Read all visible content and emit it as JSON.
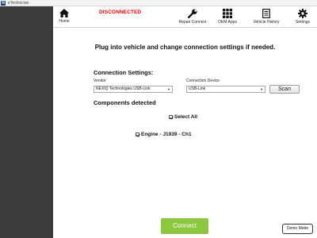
{
  "window": {
    "logo": "N",
    "title": "eTechnician"
  },
  "header": {
    "connection_status": "DISCONNECTED",
    "nav": [
      {
        "label": "Home",
        "icon": "home-icon"
      },
      {
        "label": "Repair Connect",
        "icon": "wrench-icon"
      },
      {
        "label": "OEM Apps",
        "icon": "grid-icon"
      },
      {
        "label": "Vehicle History",
        "icon": "document-icon"
      },
      {
        "label": "Settings",
        "icon": "gear-icon"
      }
    ]
  },
  "main": {
    "instruction": "Plug into vehicle and change connection settings if needed.",
    "connection_settings": {
      "title": "Connection Settings:",
      "vendor_label": "Vendor",
      "vendor_value": "NEXIQ Technologies USB-Link",
      "device_label": "Connection Device",
      "device_value": "USB-Link",
      "scan_label": "Scan"
    },
    "components": {
      "title": "Components detected",
      "select_all_label": "Select All",
      "select_all_checked": true,
      "items": [
        {
          "label": "Engine - J1939 - Ch1",
          "checked": true
        }
      ]
    },
    "connect_label": "Connect",
    "demo_mode_label": "Demo Mode"
  },
  "colors": {
    "sidebar": "#3b3b3b",
    "status_red": "#e00000",
    "connect_green": "#8dc63f"
  }
}
